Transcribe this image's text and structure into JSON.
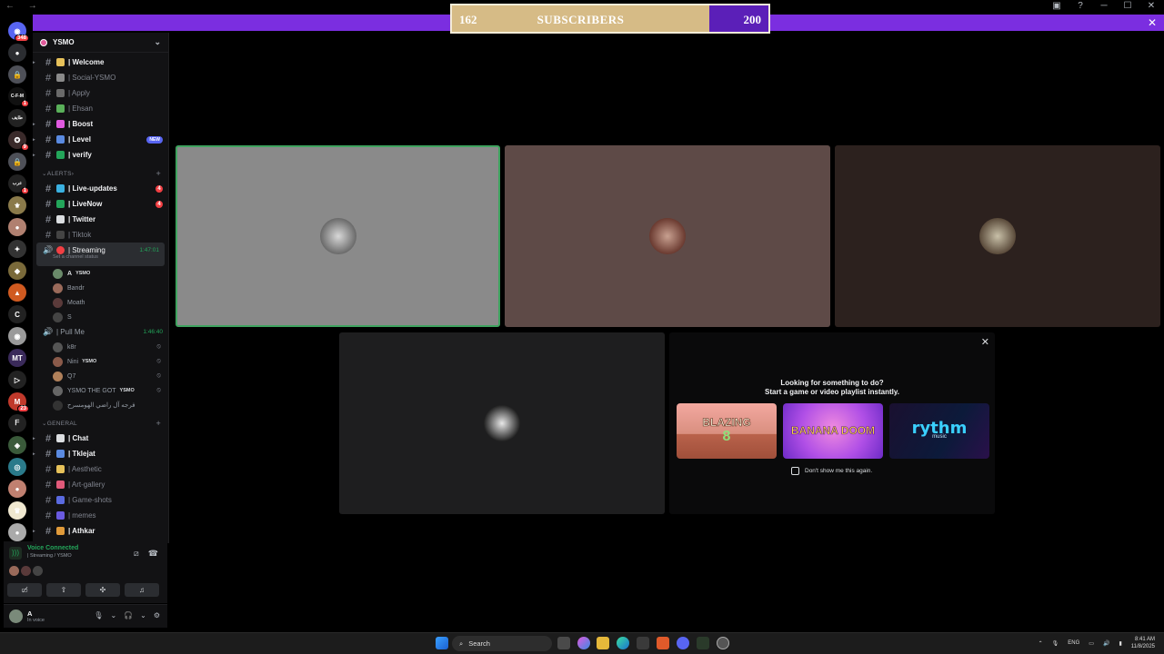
{
  "subscribers": {
    "current": "162",
    "label": "SUBSCRIBERS",
    "goal": "200"
  },
  "banner": {
    "close": "✕"
  },
  "titlebar": {
    "nav": "← →",
    "controls": [
      "▣",
      "?",
      "─",
      "☐",
      "✕"
    ]
  },
  "rail": {
    "servers": [
      {
        "icon": "discord-home-icon",
        "badge": "348",
        "color": "#5865f2",
        "text": "◉"
      },
      {
        "icon": "chat-bubble-icon",
        "color": "#2b2d31",
        "text": "●"
      },
      {
        "icon": "lock-server-icon",
        "color": "#4e5058",
        "text": "🔒"
      },
      {
        "text": "C-F-M",
        "color": "#111",
        "badge": "1"
      },
      {
        "text": "ﻃﺎﻳﻒ",
        "color": "#222"
      },
      {
        "text": "✪",
        "color": "#3a2a2a",
        "badge": "9"
      },
      {
        "icon": "lock-server-icon",
        "color": "#4e5058",
        "text": "🔒"
      },
      {
        "text": "ﻋﺮﺏ",
        "color": "#222",
        "badge": "1"
      },
      {
        "text": "⚜",
        "color": "#8a7a4a"
      },
      {
        "text": "●",
        "color": "#b08070"
      },
      {
        "text": "✦",
        "color": "#333"
      },
      {
        "text": "◆",
        "color": "#7a6a3a"
      },
      {
        "text": "▲",
        "color": "#d05a20"
      },
      {
        "text": "C",
        "color": "#222"
      },
      {
        "text": "◉",
        "color": "#9a9a9a"
      },
      {
        "text": "MT",
        "color": "#3a2a5a"
      },
      {
        "text": "▷",
        "color": "#222"
      },
      {
        "text": "M",
        "color": "#c0392b",
        "badge": "23"
      },
      {
        "text": "ᖴ",
        "color": "#222"
      },
      {
        "text": "◈",
        "color": "#3a5a3a"
      },
      {
        "text": "◎",
        "color": "#2a7a8a"
      },
      {
        "text": "●",
        "color": "#c08070"
      },
      {
        "text": "♛",
        "color": "#f0e8d0"
      },
      {
        "text": "●",
        "color": "#aaa"
      }
    ]
  },
  "sidebar": {
    "server_name": "YSMO",
    "channels_top": [
      {
        "name": "| Welcome",
        "bold": true,
        "emo": "#e6c15a",
        "arrow": true
      },
      {
        "name": "| Social-YSMO",
        "bold": false,
        "emo": "#8a8a8a"
      },
      {
        "name": "| Apply",
        "bold": false,
        "emo": "#6a6a6a"
      },
      {
        "name": "| Ehsan",
        "bold": false,
        "emo": "#5ab05a"
      },
      {
        "name": "| Boost",
        "bold": true,
        "emo": "#e05adf",
        "arrow": true
      },
      {
        "name": "| Level",
        "bold": true,
        "emo": "#5a8ae0",
        "arrow": true,
        "new": "NEW"
      },
      {
        "name": "| verify",
        "bold": true,
        "emo": "#23a55a",
        "arrow": true
      }
    ],
    "alerts_label": "ALERTS",
    "alerts": [
      {
        "name": "| Live-updates",
        "bold": true,
        "emo": "#3ab0e0",
        "badge": "4"
      },
      {
        "name": "| LiveNow",
        "bold": true,
        "emo": "#23a55a",
        "badge": "4"
      },
      {
        "name": "| Twitter",
        "bold": true,
        "emo": "#dbdee1"
      },
      {
        "name": "| Tiktok",
        "bold": false,
        "emo": "#444"
      }
    ],
    "streaming": {
      "name": "| Streaming",
      "timer": "1:47:01",
      "status": "Set a channel status"
    },
    "streaming_members": [
      {
        "name": "A",
        "tag": "YSMO",
        "me": true,
        "av": "#6a8a6a"
      },
      {
        "name": "Bandr",
        "av": "#9a6a5a"
      },
      {
        "name": "Moath",
        "av": "#5a3a3a"
      },
      {
        "name": "S",
        "av": "#444"
      }
    ],
    "pullme": {
      "name": "| Pull Me",
      "timer": "1:46:40"
    },
    "pullme_members": [
      {
        "name": "k8r",
        "av": "#555"
      },
      {
        "name": "Nini",
        "tag": "YSMO",
        "av": "#8a5a4a"
      },
      {
        "name": "Q7",
        "av": "#b0805a"
      },
      {
        "name": "YSMO THE GOT",
        "tag": "YSMO",
        "av": "#666"
      },
      {
        "name": "ﻓﺮﺟﻪ ﺁﻝ ﺭﺍﺿﻲ ﺍﻟﻬﻮﻣﺴﺮﺡ",
        "av": "#333"
      }
    ],
    "general_label": "GENERAL",
    "general": [
      {
        "name": "| Chat",
        "bold": true,
        "emo": "#dbdee1",
        "arrow": true
      },
      {
        "name": "| Tklejat",
        "bold": true,
        "emo": "#5a8ae0",
        "arrow": true
      },
      {
        "name": "| Aesthetic",
        "bold": false,
        "emo": "#e6c15a"
      },
      {
        "name": "| Art-gallery",
        "bold": false,
        "emo": "#e05a7a"
      },
      {
        "name": "| Game-shots",
        "bold": false,
        "emo": "#5a6ae0"
      },
      {
        "name": "| memes",
        "bold": false,
        "emo": "#6a5ae0"
      },
      {
        "name": "| Athkar",
        "bold": true,
        "emo": "#e09a3a",
        "arrow": true
      }
    ]
  },
  "voice": {
    "connected": "Voice Connected",
    "location": "| Streaming / YSMO"
  },
  "user": {
    "name": "A",
    "status": "In voice"
  },
  "activity": {
    "title_line1": "Looking for something to do?",
    "title_line2": "Start a game or video playlist instantly.",
    "cards": [
      {
        "name": "BLAZING",
        "sub": "8"
      },
      {
        "name": "BANANA DOOM",
        "sub": ""
      },
      {
        "name": "rythm",
        "sub": "music"
      }
    ],
    "dont_show": "Don't show me this again."
  },
  "taskbar": {
    "search": "Search",
    "lang": "ENG",
    "time": "8:41 AM",
    "date": "11/8/2025"
  }
}
